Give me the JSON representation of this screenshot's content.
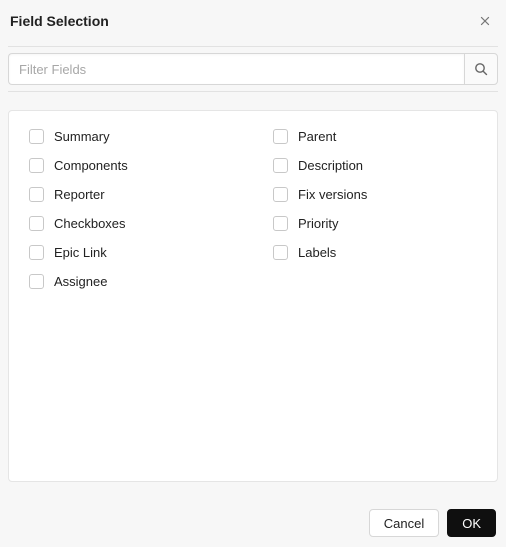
{
  "title": "Field Selection",
  "search": {
    "placeholder": "Filter Fields",
    "value": ""
  },
  "leftFields": [
    {
      "label": "Summary"
    },
    {
      "label": "Components"
    },
    {
      "label": "Reporter"
    },
    {
      "label": "Checkboxes"
    },
    {
      "label": "Epic Link"
    },
    {
      "label": "Assignee"
    }
  ],
  "rightFields": [
    {
      "label": "Parent"
    },
    {
      "label": "Description"
    },
    {
      "label": "Fix versions"
    },
    {
      "label": "Priority"
    },
    {
      "label": "Labels"
    }
  ],
  "buttons": {
    "cancel": "Cancel",
    "ok": "OK"
  }
}
